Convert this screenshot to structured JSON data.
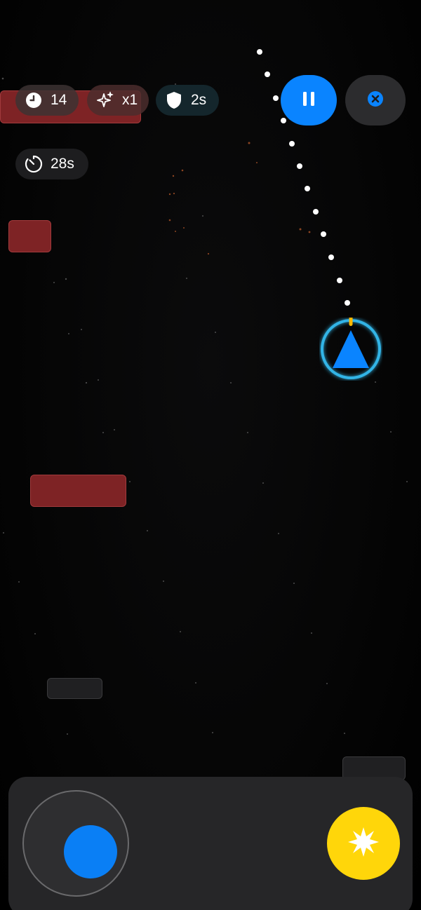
{
  "hud": {
    "score": {
      "icon": "clock-icon",
      "value": "14"
    },
    "multiplier": {
      "icon": "sparkles-icon",
      "value": "x1"
    },
    "shield": {
      "icon": "shield-icon",
      "value": "2s"
    },
    "timer": {
      "icon": "stopwatch-icon",
      "value": "28s"
    }
  },
  "controls": {
    "pause": {
      "icon": "pause-icon"
    },
    "close": {
      "icon": "close-circle-icon"
    },
    "joystick": {
      "icon": "joystick-knob"
    },
    "fire": {
      "icon": "burst-icon"
    }
  },
  "player": {
    "icon": "triangle-ship-icon"
  },
  "colors": {
    "accent_blue": "#0a84ff",
    "player_ring": "#32b4e6",
    "fire_yellow": "#ffd60a",
    "hazard_red": "#7e2325",
    "aim_tip": "#ffb800",
    "trajectory": "#ffffff"
  }
}
